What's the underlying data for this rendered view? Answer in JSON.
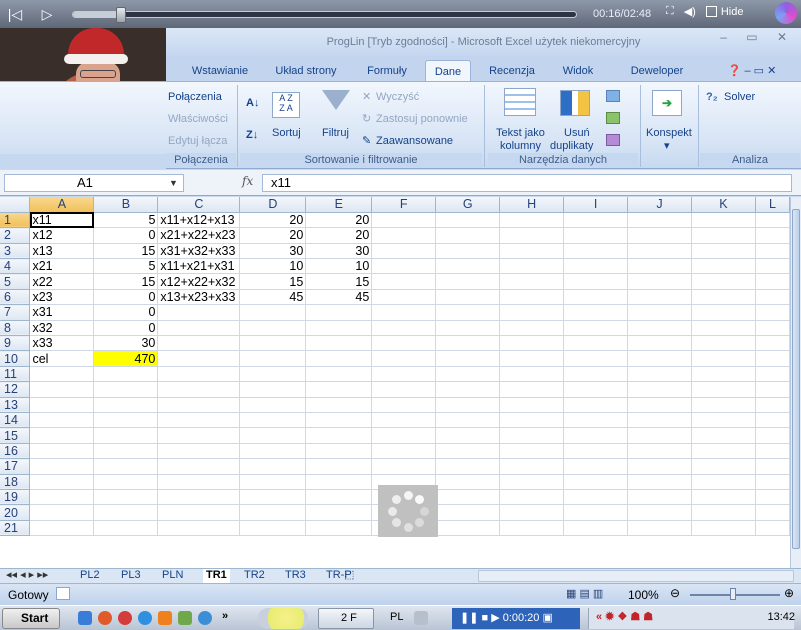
{
  "player": {
    "time": "00:16/02:48",
    "hide_label": "Hide",
    "progress_fraction": 0.095
  },
  "excel": {
    "window_title": "ProgLin  [Tryb zgodności] - Microsoft Excel użytek niekomercyjny",
    "tabs": [
      "Wstawianie",
      "Układ strony",
      "Formuły",
      "Dane",
      "Recenzja",
      "Widok",
      "Deweloper"
    ],
    "active_tab": "Dane",
    "ribbon": {
      "connections": {
        "items": [
          "Połączenia",
          "Właściwości",
          "Edytuj łącza"
        ],
        "group_label": "Połączenia"
      },
      "sort_filter": {
        "sort_label": "Sortuj",
        "filter_label": "Filtruj",
        "clear_label": "Wyczyść",
        "reapply_label": "Zastosuj ponownie",
        "advanced_label": "Zaawansowane",
        "group_label": "Sortowanie i filtrowanie"
      },
      "data_tools": {
        "text_to_columns_1": "Tekst jako",
        "text_to_columns_2": "kolumny",
        "remove_dup_1": "Usuń",
        "remove_dup_2": "duplikaty",
        "group_label": "Narzędzia danych"
      },
      "outline": {
        "label": "Konspekt"
      },
      "analysis": {
        "solver_label": "Solver",
        "group_label": "Analiza"
      }
    },
    "name_box": "A1",
    "formula_content": "x11",
    "fx_label": "fx",
    "columns": [
      "A",
      "B",
      "C",
      "D",
      "E",
      "F",
      "G",
      "H",
      "I",
      "J",
      "K",
      "L"
    ],
    "rows": [
      [
        "x11",
        "5",
        "x11+x12+x13",
        "20",
        "20"
      ],
      [
        "x12",
        "0",
        "x21+x22+x23",
        "20",
        "20"
      ],
      [
        "x13",
        "15",
        "x31+x32+x33",
        "30",
        "30"
      ],
      [
        "x21",
        "5",
        "x11+x21+x31",
        "10",
        "10"
      ],
      [
        "x22",
        "15",
        "x12+x22+x32",
        "15",
        "15"
      ],
      [
        "x23",
        "0",
        "x13+x23+x33",
        "45",
        "45"
      ],
      [
        "x31",
        "0",
        "",
        "",
        ""
      ],
      [
        "x32",
        "0",
        "",
        "",
        ""
      ],
      [
        "x33",
        "30",
        "",
        "",
        ""
      ],
      [
        "cel",
        "470",
        "",
        "",
        ""
      ],
      [
        "",
        "",
        "",
        "",
        ""
      ],
      [
        "",
        "",
        "",
        "",
        ""
      ],
      [
        "",
        "",
        "",
        "",
        ""
      ],
      [
        "",
        "",
        "",
        "",
        ""
      ],
      [
        "",
        "",
        "",
        "",
        ""
      ],
      [
        "",
        "",
        "",
        "",
        ""
      ],
      [
        "",
        "",
        "",
        "",
        ""
      ],
      [
        "",
        "",
        "",
        "",
        ""
      ],
      [
        "",
        "",
        "",
        "",
        ""
      ],
      [
        "",
        "",
        "",
        "",
        ""
      ],
      [
        "",
        "",
        "",
        "",
        ""
      ]
    ],
    "sheets": [
      "PL2",
      "PL3",
      "PLN",
      "TR1",
      "TR2",
      "TR3",
      "TR-P"
    ],
    "active_sheet": "TR1",
    "status_text": "Gotowy",
    "zoom": "100%"
  },
  "taskbar": {
    "start_label": "Start",
    "lang": "PL",
    "recording_time": "0:00:20",
    "clock": "13:42",
    "app_item_label": "2 F"
  }
}
